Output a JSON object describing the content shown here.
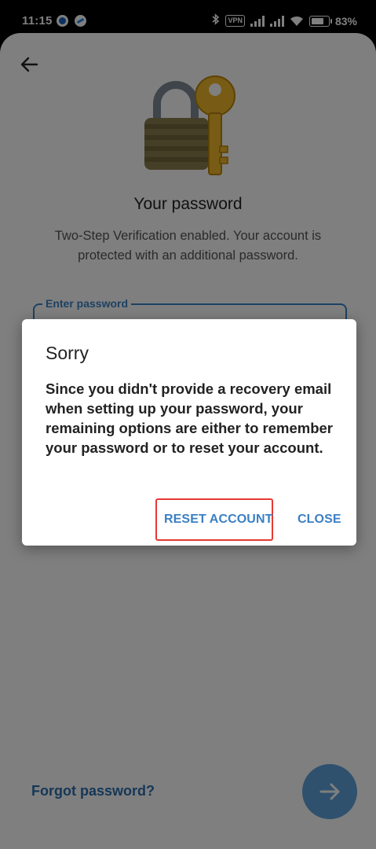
{
  "status_bar": {
    "time": "11:15",
    "vpn_label": "VPN",
    "battery_percent": "83%",
    "battery_level": 0.83,
    "icons": [
      "globe-icon",
      "app-icon",
      "bluetooth-icon",
      "signal-icon",
      "wifi-icon",
      "battery-icon"
    ]
  },
  "screen": {
    "back_icon": "arrow-left-icon",
    "illustration": "padlock-with-key",
    "title": "Your password",
    "subtitle": "Two-Step Verification enabled. Your account is protected with an additional password.",
    "password_field": {
      "label": "Enter password",
      "value": ""
    },
    "forgot_link": "Forgot password?",
    "next_button_icon": "arrow-right-icon"
  },
  "dialog": {
    "title": "Sorry",
    "message": "Since you didn't provide a recovery email when setting up your password, your remaining options are either to remember your password or to reset your account.",
    "reset_label": "RESET ACCOUNT",
    "close_label": "CLOSE"
  },
  "colors": {
    "accent": "#3b7fc4",
    "link": "#2d6fb0",
    "fab": "#5fa2dd",
    "highlight": "#e53935",
    "overlay": "rgba(0,0,0,0.5)"
  }
}
